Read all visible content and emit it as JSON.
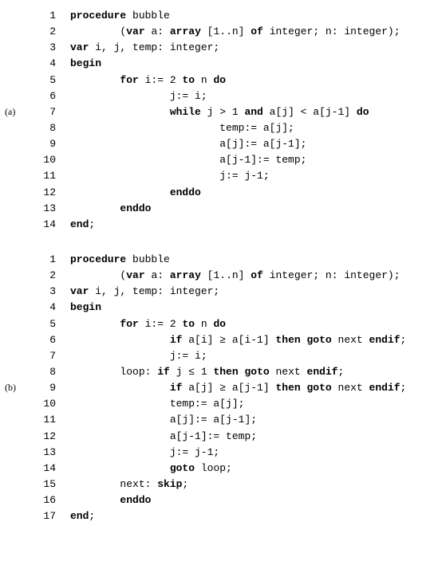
{
  "labels": {
    "a": "(a)",
    "b": "(b)"
  },
  "kw": {
    "procedure": "procedure",
    "var": "var",
    "array": "array",
    "of": "of",
    "begin": "begin",
    "for": "for",
    "to": "to",
    "do": "do",
    "while": "while",
    "and": "and",
    "enddo": "enddo",
    "end": "end",
    "if": "if",
    "then": "then",
    "goto": "goto",
    "endif": "endif",
    "skip": "skip"
  },
  "listingA": {
    "lines": [
      {
        "n": "1",
        "indent": 0,
        "tokens": [
          {
            "t": "procedure",
            "b": true
          },
          {
            "t": " bubble"
          }
        ]
      },
      {
        "n": "2",
        "indent": 2,
        "tokens": [
          {
            "t": "("
          },
          {
            "t": "var",
            "b": true
          },
          {
            "t": " a: "
          },
          {
            "t": "array",
            "b": true
          },
          {
            "t": " [1..n] "
          },
          {
            "t": "of",
            "b": true
          },
          {
            "t": " integer; n: integer);"
          }
        ]
      },
      {
        "n": "3",
        "indent": 0,
        "tokens": [
          {
            "t": "var",
            "b": true
          },
          {
            "t": " i, j, temp: integer;"
          }
        ]
      },
      {
        "n": "4",
        "indent": 0,
        "tokens": [
          {
            "t": "begin",
            "b": true
          }
        ]
      },
      {
        "n": "5",
        "indent": 2,
        "tokens": [
          {
            "t": "for",
            "b": true
          },
          {
            "t": " i:= 2 "
          },
          {
            "t": "to",
            "b": true
          },
          {
            "t": " n "
          },
          {
            "t": "do",
            "b": true
          }
        ]
      },
      {
        "n": "6",
        "indent": 4,
        "tokens": [
          {
            "t": "j:= i;"
          }
        ]
      },
      {
        "n": "7",
        "indent": 4,
        "tokens": [
          {
            "t": "while",
            "b": true
          },
          {
            "t": " j > 1 "
          },
          {
            "t": "and",
            "b": true
          },
          {
            "t": " a[j] < a[j-1] "
          },
          {
            "t": "do",
            "b": true
          }
        ],
        "rowLabel": "a"
      },
      {
        "n": "8",
        "indent": 6,
        "tokens": [
          {
            "t": "temp:= a[j];"
          }
        ]
      },
      {
        "n": "9",
        "indent": 6,
        "tokens": [
          {
            "t": "a[j]:= a[j-1];"
          }
        ]
      },
      {
        "n": "10",
        "indent": 6,
        "tokens": [
          {
            "t": "a[j-1]:= temp;"
          }
        ]
      },
      {
        "n": "11",
        "indent": 6,
        "tokens": [
          {
            "t": "j:= j-1;"
          }
        ]
      },
      {
        "n": "12",
        "indent": 4,
        "tokens": [
          {
            "t": "enddo",
            "b": true
          }
        ]
      },
      {
        "n": "13",
        "indent": 2,
        "tokens": [
          {
            "t": "enddo",
            "b": true
          }
        ]
      },
      {
        "n": "14",
        "indent": 0,
        "tokens": [
          {
            "t": "end",
            "b": true
          },
          {
            "t": ";"
          }
        ]
      }
    ]
  },
  "listingB": {
    "lines": [
      {
        "n": "1",
        "indent": 0,
        "tokens": [
          {
            "t": "procedure",
            "b": true
          },
          {
            "t": " bubble"
          }
        ]
      },
      {
        "n": "2",
        "indent": 2,
        "tokens": [
          {
            "t": "("
          },
          {
            "t": "var",
            "b": true
          },
          {
            "t": " a: "
          },
          {
            "t": "array",
            "b": true
          },
          {
            "t": " [1..n] "
          },
          {
            "t": "of",
            "b": true
          },
          {
            "t": " integer; n: integer);"
          }
        ]
      },
      {
        "n": "3",
        "indent": 0,
        "tokens": [
          {
            "t": "var",
            "b": true
          },
          {
            "t": " i, j, temp: integer;"
          }
        ]
      },
      {
        "n": "4",
        "indent": 0,
        "tokens": [
          {
            "t": "begin",
            "b": true
          }
        ]
      },
      {
        "n": "5",
        "indent": 2,
        "tokens": [
          {
            "t": "for",
            "b": true
          },
          {
            "t": " i:= 2 "
          },
          {
            "t": "to",
            "b": true
          },
          {
            "t": " n "
          },
          {
            "t": "do",
            "b": true
          }
        ]
      },
      {
        "n": "6",
        "indent": 4,
        "tokens": [
          {
            "t": "if",
            "b": true
          },
          {
            "t": " a[i] ≥ a[i-1] "
          },
          {
            "t": "then",
            "b": true
          },
          {
            "t": " "
          },
          {
            "t": "goto",
            "b": true
          },
          {
            "t": " next "
          },
          {
            "t": "endif",
            "b": true
          },
          {
            "t": ";"
          }
        ]
      },
      {
        "n": "7",
        "indent": 4,
        "tokens": [
          {
            "t": "j:= i;"
          }
        ]
      },
      {
        "n": "8",
        "indent": 2,
        "tokens": [
          {
            "t": "loop: "
          },
          {
            "t": "if",
            "b": true
          },
          {
            "t": " j ≤ 1 "
          },
          {
            "t": "then",
            "b": true
          },
          {
            "t": " "
          },
          {
            "t": "goto",
            "b": true
          },
          {
            "t": " next "
          },
          {
            "t": "endif",
            "b": true
          },
          {
            "t": ";"
          }
        ]
      },
      {
        "n": "9",
        "indent": 4,
        "tokens": [
          {
            "t": "if",
            "b": true
          },
          {
            "t": " a[j] ≥ a[j-1] "
          },
          {
            "t": "then",
            "b": true
          },
          {
            "t": " "
          },
          {
            "t": "goto",
            "b": true
          },
          {
            "t": " next "
          },
          {
            "t": "endif",
            "b": true
          },
          {
            "t": ";"
          }
        ],
        "rowLabel": "b"
      },
      {
        "n": "10",
        "indent": 4,
        "tokens": [
          {
            "t": "temp:= a[j];"
          }
        ]
      },
      {
        "n": "11",
        "indent": 4,
        "tokens": [
          {
            "t": "a[j]:= a[j-1];"
          }
        ]
      },
      {
        "n": "12",
        "indent": 4,
        "tokens": [
          {
            "t": "a[j-1]:= temp;"
          }
        ]
      },
      {
        "n": "13",
        "indent": 4,
        "tokens": [
          {
            "t": "j:= j-1;"
          }
        ]
      },
      {
        "n": "14",
        "indent": 4,
        "tokens": [
          {
            "t": "goto",
            "b": true
          },
          {
            "t": " loop;"
          }
        ]
      },
      {
        "n": "15",
        "indent": 2,
        "tokens": [
          {
            "t": "next: "
          },
          {
            "t": "skip",
            "b": true
          },
          {
            "t": ";"
          }
        ]
      },
      {
        "n": "16",
        "indent": 2,
        "tokens": [
          {
            "t": "enddo",
            "b": true
          }
        ]
      },
      {
        "n": "17",
        "indent": 0,
        "tokens": [
          {
            "t": "end",
            "b": true
          },
          {
            "t": ";"
          }
        ]
      }
    ]
  }
}
